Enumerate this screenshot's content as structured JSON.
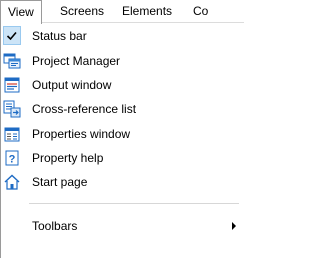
{
  "menubar": {
    "items": [
      {
        "label": "View",
        "active": true
      },
      {
        "label": "Screens"
      },
      {
        "label": "Elements"
      },
      {
        "label": "Co"
      }
    ]
  },
  "view_menu": {
    "items": [
      {
        "label": "Status bar",
        "icon": "checkmark-icon",
        "checked": true
      },
      {
        "label": "Project Manager",
        "icon": "project-manager-icon"
      },
      {
        "label": "Output window",
        "icon": "output-window-icon"
      },
      {
        "label": "Cross-reference list",
        "icon": "cross-reference-icon"
      },
      {
        "label": "Properties window",
        "icon": "properties-window-icon"
      },
      {
        "label": "Property help",
        "icon": "help-icon"
      },
      {
        "label": "Start page",
        "icon": "home-icon"
      },
      {
        "label": "Toolbars",
        "icon": "",
        "submenu": true
      }
    ]
  },
  "colors": {
    "check_highlight": "#cce4f7",
    "icon_blue": "#1e6bc4",
    "menu_border": "#9a9a9a"
  }
}
